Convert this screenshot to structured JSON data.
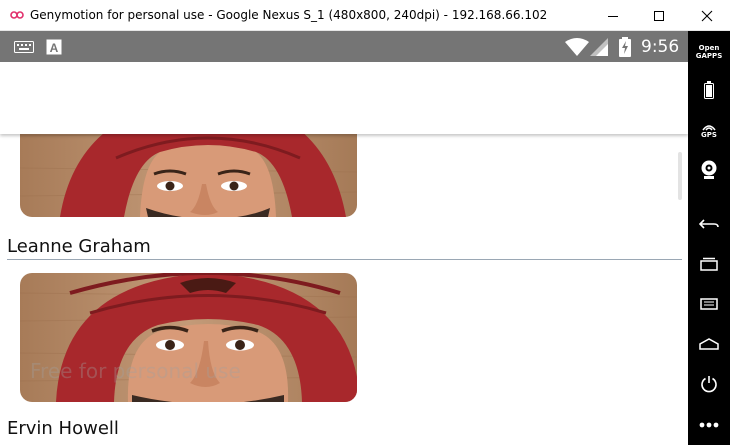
{
  "window": {
    "title": "Genymotion for personal use - Google Nexus S_1 (480x800, 240dpi) - 192.168.66.102",
    "controls": {
      "minimize": "minimize-icon",
      "maximize": "maximize-icon",
      "close": "close-icon"
    }
  },
  "statusbar": {
    "left_icons": [
      "keyboard-icon",
      "a-icon"
    ],
    "right_icons": [
      "wifi-icon",
      "signal-icon",
      "battery-icon"
    ],
    "time": "9:56",
    "color": "#757575"
  },
  "list": {
    "items": [
      {
        "name": "Leanne Graham",
        "image": "profile-photo-turban"
      },
      {
        "name": "Ervin Howell",
        "image": "profile-photo-turban"
      }
    ]
  },
  "watermark": "Free for personal use",
  "sidebar": {
    "buttons": [
      {
        "id": "open-gapps",
        "label_line1": "Open",
        "label_line2": "GAPPS"
      },
      {
        "id": "battery",
        "icon": "battery-icon"
      },
      {
        "id": "gps",
        "label": "GPS"
      },
      {
        "id": "camera",
        "icon": "webcam-icon"
      },
      {
        "id": "back",
        "icon": "back-icon"
      },
      {
        "id": "recent-apps",
        "icon": "recent-apps-icon"
      },
      {
        "id": "menu",
        "icon": "menu-icon"
      },
      {
        "id": "home",
        "icon": "home-icon"
      },
      {
        "id": "power",
        "icon": "power-icon"
      },
      {
        "id": "more",
        "icon": "more-icon"
      }
    ]
  },
  "colors": {
    "accent_divider": "#9aa7b4",
    "turban": "#a8282c",
    "background_wood": "#b88c68",
    "sidebar": "#000000"
  }
}
